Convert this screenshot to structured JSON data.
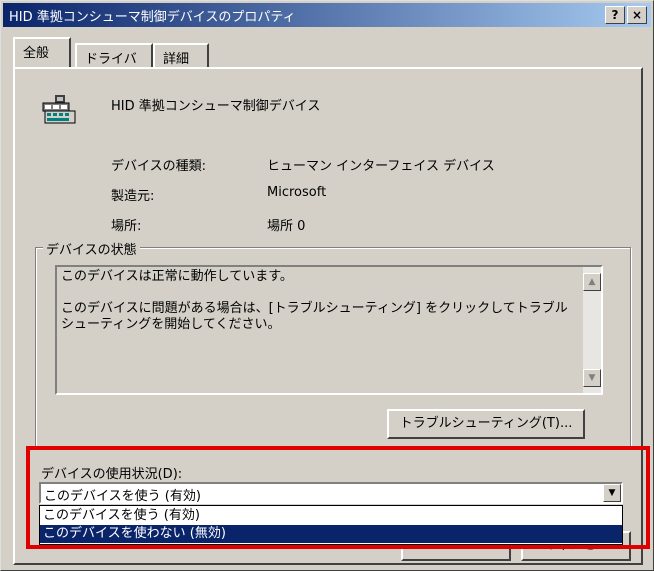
{
  "window": {
    "title": "HID 準拠コンシューマ制御デバイスのプロパティ",
    "help_button": "?",
    "close_button": "×"
  },
  "tabs": [
    {
      "label": "全般",
      "active": true
    },
    {
      "label": "ドライバ",
      "active": false
    },
    {
      "label": "詳細",
      "active": false
    }
  ],
  "device": {
    "icon": "hid-device-icon",
    "name": "HID 準拠コンシューマ制御デバイス",
    "properties": [
      {
        "label": "デバイスの種類:",
        "value": "ヒューマン インターフェイス デバイス"
      },
      {
        "label": "製造元:",
        "value": "Microsoft"
      },
      {
        "label": "場所:",
        "value": "場所 0"
      }
    ]
  },
  "status": {
    "group_label": "デバイスの状態",
    "line1": "このデバイスは正常に動作しています。",
    "line2": "このデバイスに問題がある場合は、[トラブルシューティング] をクリックしてトラブルシューティングを開始してください。",
    "troubleshoot_button": "トラブルシューティング(T)..."
  },
  "usage": {
    "label": "デバイスの使用状況(D):",
    "selected": "このデバイスを使う (有効)",
    "options": [
      {
        "label": "このデバイスを使う (有効)",
        "highlighted": false
      },
      {
        "label": "このデバイスを使わない (無効)",
        "highlighted": true
      }
    ]
  },
  "footer": {
    "ok_button": "OK",
    "cancel_button": "キャンセル"
  },
  "colors": {
    "annotation_border": "#e00000",
    "titlebar": "#0a246a",
    "selection": "#0a246a",
    "face": "#d4d0c8"
  }
}
